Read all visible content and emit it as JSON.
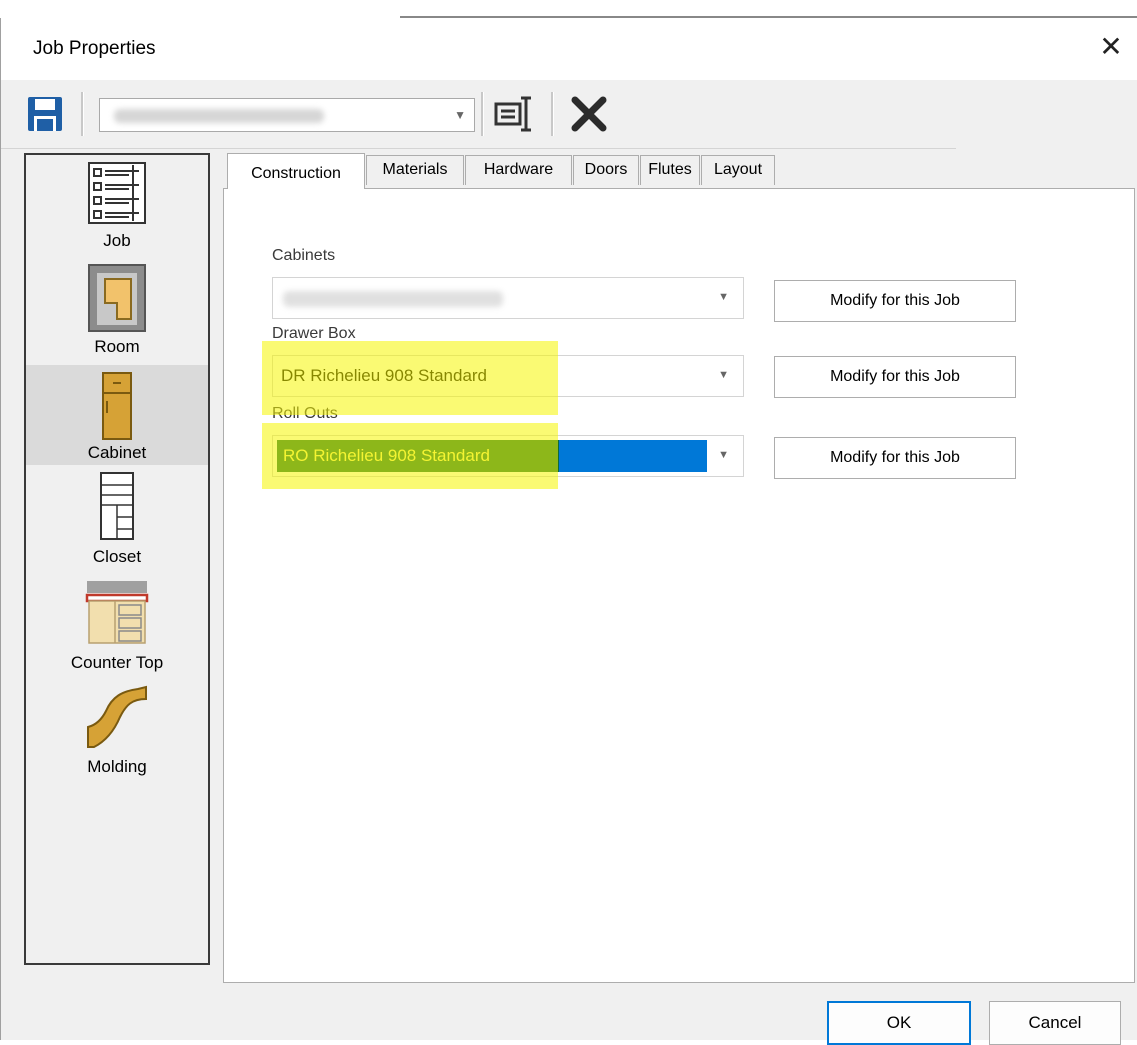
{
  "window": {
    "title": "Job Properties"
  },
  "toolbar": {
    "job_combo_value": "",
    "icons": [
      "save-icon",
      "properties-icon",
      "delete-icon"
    ]
  },
  "sidebar": {
    "items": [
      {
        "label": "Job",
        "icon": "job-list-icon",
        "selected": false
      },
      {
        "label": "Room",
        "icon": "room-icon",
        "selected": false
      },
      {
        "label": "Cabinet",
        "icon": "cabinet-icon",
        "selected": true
      },
      {
        "label": "Closet",
        "icon": "closet-icon",
        "selected": false
      },
      {
        "label": "Counter Top",
        "icon": "counter-top-icon",
        "selected": false
      },
      {
        "label": "Molding",
        "icon": "molding-icon",
        "selected": false
      }
    ]
  },
  "tabs": [
    {
      "label": "Construction",
      "active": true
    },
    {
      "label": "Materials",
      "active": false
    },
    {
      "label": "Hardware",
      "active": false
    },
    {
      "label": "Doors",
      "active": false
    },
    {
      "label": "Flutes",
      "active": false
    },
    {
      "label": "Layout",
      "active": false
    }
  ],
  "construction": {
    "fields": [
      {
        "label": "Cabinets",
        "value": "",
        "button": "Modify for this Job"
      },
      {
        "label": "Drawer Box",
        "value": "DR Richelieu 908 Standard",
        "button": "Modify for this Job"
      },
      {
        "label": "Roll Outs",
        "value": "RO Richelieu 908 Standard",
        "button": "Modify for this Job"
      }
    ]
  },
  "dialog_buttons": {
    "ok": "OK",
    "cancel": "Cancel"
  },
  "colors": {
    "accent": "#0078d7",
    "highlight": "#f5f500",
    "selection_text": "#f2f270"
  }
}
